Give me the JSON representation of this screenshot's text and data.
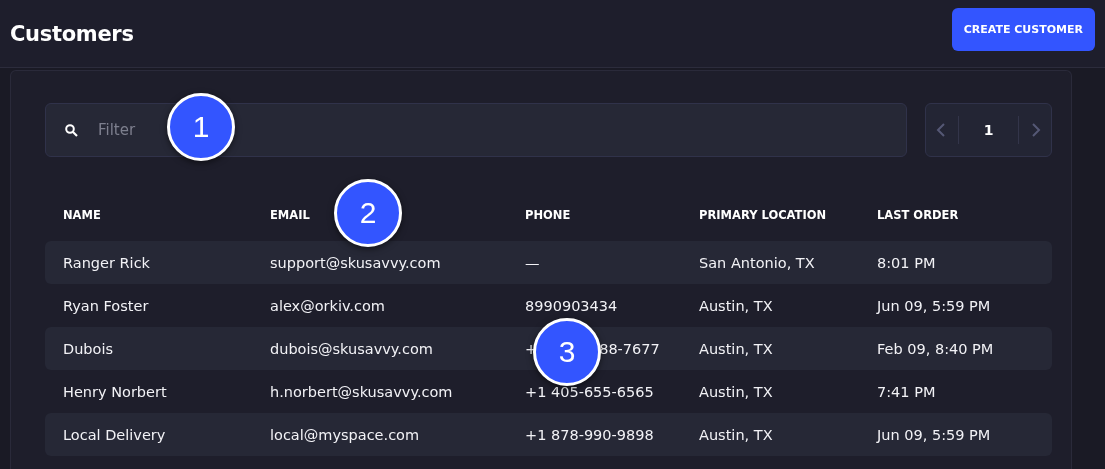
{
  "header": {
    "title": "Customers",
    "create_button": "CREATE CUSTOMER"
  },
  "filter": {
    "placeholder": "Filter"
  },
  "pager": {
    "page": "1",
    "prev_disabled": true,
    "next_disabled": true
  },
  "table": {
    "columns": [
      "NAME",
      "EMAIL",
      "PHONE",
      "PRIMARY LOCATION",
      "LAST ORDER"
    ],
    "rows": [
      {
        "name": "Ranger Rick",
        "email": "support@skusavvy.com",
        "phone": [
          "—"
        ],
        "location": "San Antonio, TX",
        "last_order": "8:01 PM"
      },
      {
        "name": "Ryan Foster",
        "email": "alex@orkiv.com",
        "phone": [
          "8990903434"
        ],
        "location": "Austin, TX",
        "last_order": "Jun 09, 5:59 PM"
      },
      {
        "name": "Dubois",
        "email": "dubois@skusavvy.com",
        "phone": [
          "+",
          "88-7677"
        ],
        "location": "Austin, TX",
        "last_order": "Feb 09, 8:40 PM"
      },
      {
        "name": "Henry Norbert",
        "email": "h.norbert@skusavvy.com",
        "phone": [
          "+1 405-655-6565"
        ],
        "location": "Austin, TX",
        "last_order": "7:41 PM"
      },
      {
        "name": "Local Delivery",
        "email": "local@myspace.com",
        "phone": [
          "+1 878-990-9898"
        ],
        "location": "Austin, TX",
        "last_order": "Jun 09, 5:59 PM"
      }
    ]
  },
  "callouts": [
    {
      "label": "1"
    },
    {
      "label": "2"
    },
    {
      "label": "3"
    }
  ]
}
